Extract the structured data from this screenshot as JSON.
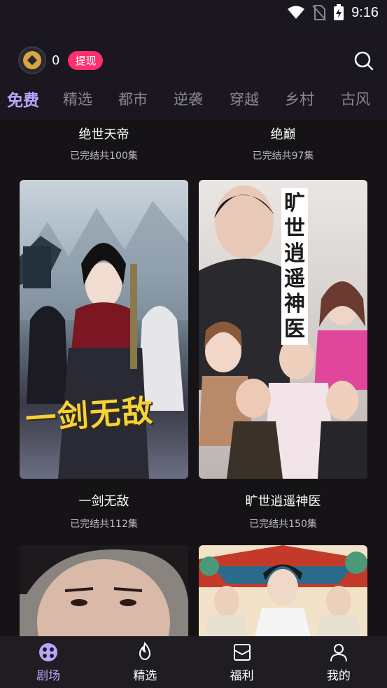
{
  "status_bar": {
    "time": "9:16"
  },
  "header": {
    "coin_count": "0",
    "withdraw_label": "提现"
  },
  "tabs": [
    "免费",
    "精选",
    "都市",
    "逆袭",
    "穿越",
    "乡村",
    "古风"
  ],
  "dramas_top": [
    {
      "title": "绝世天帝",
      "status": "已完结共100集"
    },
    {
      "title": "绝巅",
      "status": "已完结共97集"
    }
  ],
  "dramas": [
    {
      "title": "一剑无敌",
      "status": "已完结共112集",
      "poster_text": "一剑无敌"
    },
    {
      "title": "旷世逍遥神医",
      "status": "已完结共150集",
      "poster_text": "旷世逍遥神医"
    }
  ],
  "bottom_nav": [
    {
      "label": "剧场",
      "icon": "theater-icon",
      "active": true
    },
    {
      "label": "精选",
      "icon": "flame-icon",
      "active": false
    },
    {
      "label": "福利",
      "icon": "gift-icon",
      "active": false
    },
    {
      "label": "我的",
      "icon": "person-icon",
      "active": false
    }
  ],
  "colors": {
    "accent": "#b8a6ff",
    "withdraw_bg": "#ff2f6d",
    "background": "#151316",
    "header_bg": "#1a1720"
  }
}
